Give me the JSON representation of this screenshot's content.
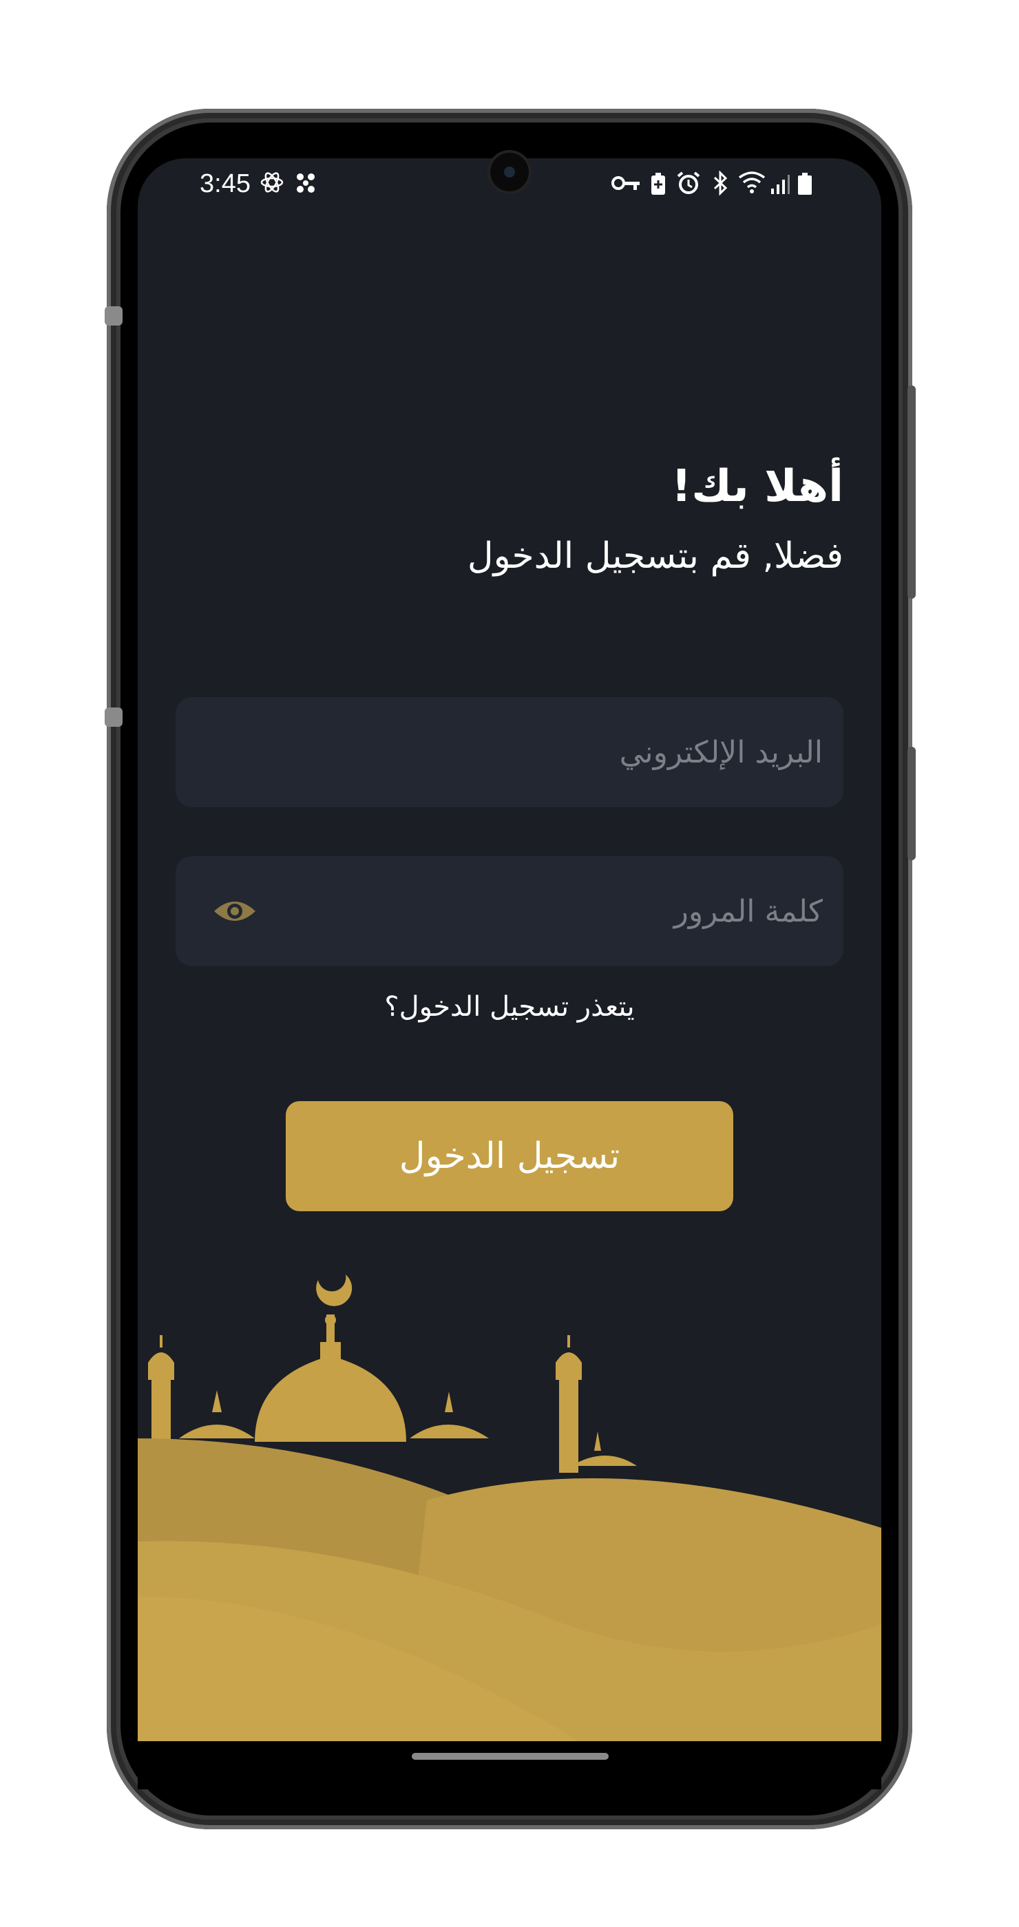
{
  "status_bar": {
    "time": "3:45",
    "left_icons": [
      "atom-icon",
      "fan-icon"
    ],
    "right_icons": [
      "vpn-key-icon",
      "battery-saver-icon",
      "alarm-icon",
      "bluetooth-icon",
      "wifi-icon",
      "signal-icon",
      "battery-icon"
    ]
  },
  "login": {
    "welcome_title": "أهلا بك!",
    "subtitle": "فضلا, قم بتسجيل الدخول",
    "email_placeholder": "البريد الإلكتروني",
    "email_value": "",
    "password_placeholder": "كلمة المرور",
    "password_value": "",
    "forgot_link": "يتعذر تسجيل الدخول؟",
    "submit_label": "تسجيل الدخول"
  },
  "colors": {
    "background": "#1b1e24",
    "field": "#222731",
    "accent_gold": "#c6a147",
    "placeholder": "#7c8088",
    "eye_icon": "#8d7a45"
  },
  "decoration": "mosque-silhouette-illustration"
}
